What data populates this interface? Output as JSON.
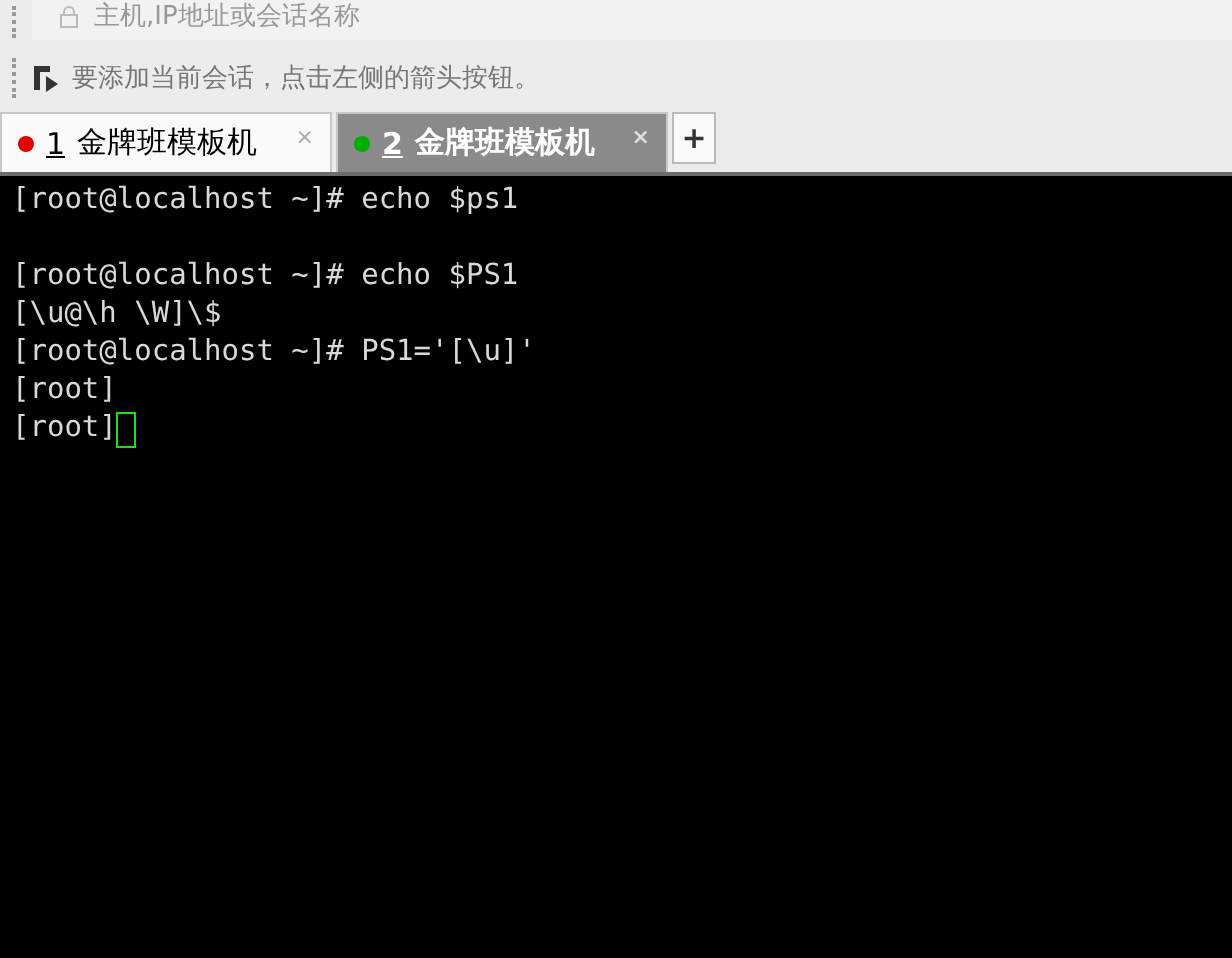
{
  "address_bar": {
    "placeholder": "主机,IP地址或会话名称"
  },
  "hint": {
    "text": "要添加当前会话，点击左侧的箭头按钮。"
  },
  "tabs": [
    {
      "number": "1",
      "label": "金牌班模板机",
      "selected": false,
      "color": "#e00000",
      "close": "×"
    },
    {
      "number": "2",
      "label": "金牌班模板机",
      "selected": true,
      "color": "#00b000",
      "close": "×"
    }
  ],
  "add_tab": "+",
  "terminal": {
    "lines": [
      {
        "kind": "text",
        "text": "[root@localhost ~]# echo $ps1"
      },
      {
        "kind": "blank"
      },
      {
        "kind": "text",
        "text": "[root@localhost ~]# echo $PS1"
      },
      {
        "kind": "text",
        "text": "[\\u@\\h \\W]\\$"
      },
      {
        "kind": "text",
        "text": "[root@localhost ~]# PS1='[\\u]'"
      },
      {
        "kind": "text",
        "text": "[root]"
      },
      {
        "kind": "text",
        "text": "[root]"
      }
    ],
    "cursor": true
  }
}
